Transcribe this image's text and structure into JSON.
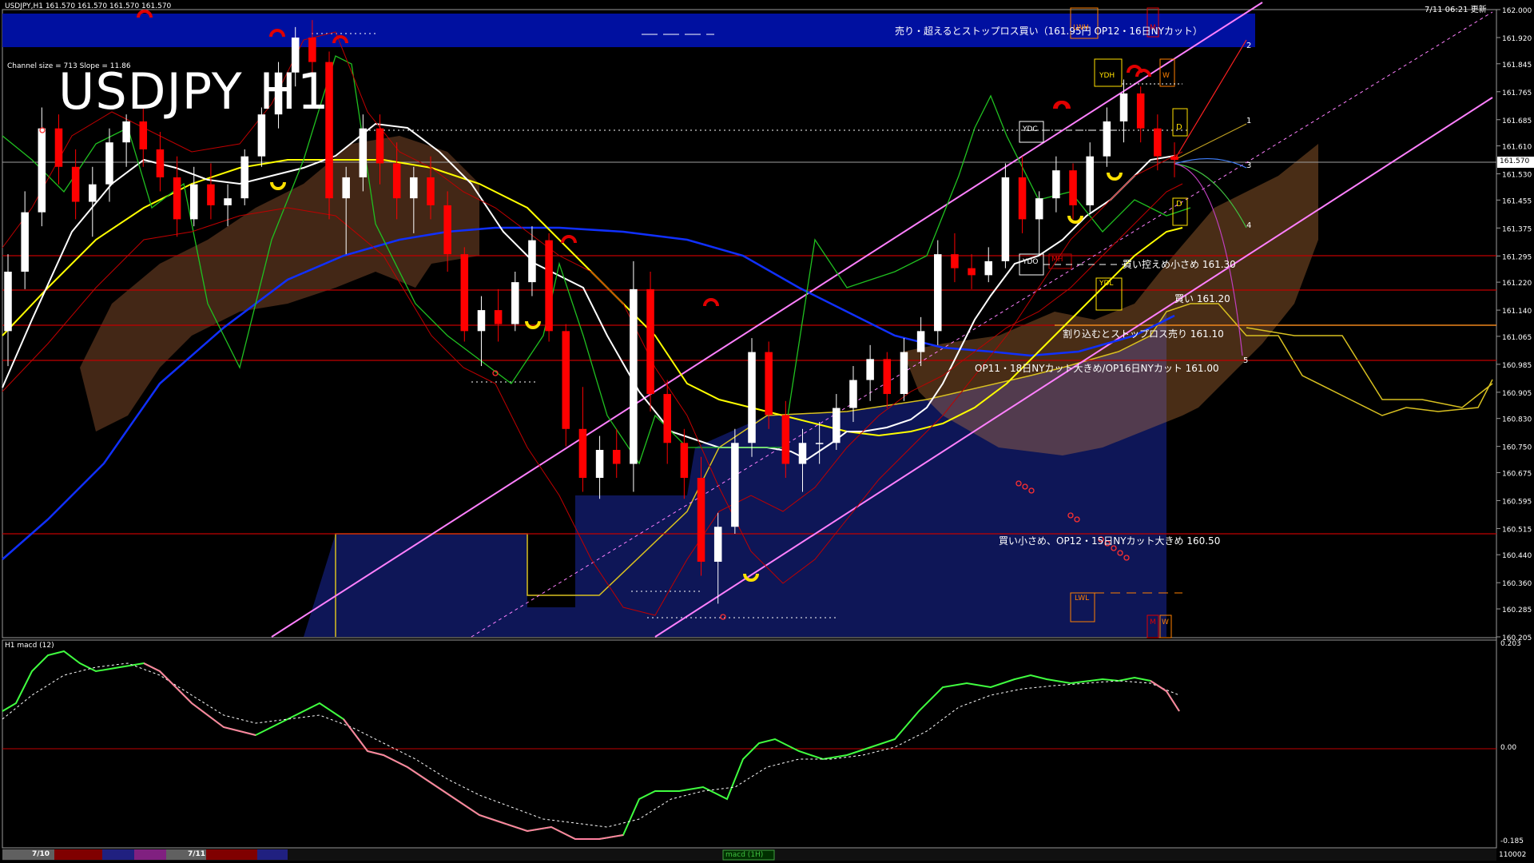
{
  "header": {
    "symbol_line": "USDJPY,H1  161.570 161.570 161.570 161.570",
    "timestamp": "7/11 06:21 更新",
    "big_title": "USDJPY H1",
    "channel_info": "Channel size = 713 Slope = 11.86",
    "banner_text": "売り・超えるとストップロス買い（161.95円 OP12・16日NYカット）"
  },
  "colors": {
    "background": "#000000",
    "bull_candle": "#ffffff",
    "bear_candle": "#ff0000",
    "ma_fast": "#ffffff",
    "ma_mid": "#ffff00",
    "ma_slow": "#0000ff",
    "channel": "#ff80ff",
    "banner": "#0010a0",
    "hline": "#c00000",
    "macd_up": "#40ff40",
    "macd_down": "#ff80a0",
    "grid_box": "#ffffff"
  },
  "price_axis": {
    "ticks": [
      "162.000",
      "161.920",
      "161.845",
      "161.765",
      "161.685",
      "161.610",
      "161.530",
      "161.455",
      "161.375",
      "161.295",
      "161.220",
      "161.140",
      "161.065",
      "160.985",
      "160.905",
      "160.830",
      "160.750",
      "160.675",
      "160.595",
      "160.515",
      "160.440",
      "160.360",
      "160.285",
      "160.205"
    ],
    "current_price": "161.570"
  },
  "annotations": {
    "level_161_30": "買い控えめ小さめ 161.30",
    "level_161_20": "買い 161.20",
    "level_161_10": "割り込むとストップロス売り 161.10",
    "level_161_00": "OP11・18日NYカット大きめ/OP16日NYカット 161.00",
    "level_160_50": "買い小さめ、OP12・15日NYカット大きめ 160.50"
  },
  "markers": {
    "ydc_top": "YDC",
    "ydo": "YDO",
    "ydh": "YDH",
    "ydl": "YDL",
    "lwh": "LWH",
    "lwl": "LWL",
    "mh": "MH",
    "m_top": "M",
    "w_top": "W",
    "d_upper": "D",
    "d_lower": "D",
    "m_bottom": "M",
    "w_bottom": "W"
  },
  "fib_labels": [
    "2",
    "1",
    "3",
    "4",
    "5"
  ],
  "macd": {
    "label": "H1  macd (12)",
    "axis_top": "0.203",
    "axis_zero": "0.00",
    "axis_bottom": "-0.185"
  },
  "footer": {
    "date_1": "7/10",
    "date_2": "7/11",
    "corner": "110002",
    "tab": "macd (1H)"
  },
  "chart_data": {
    "type": "candlestick",
    "title": "USDJPY H1",
    "ylim": [
      160.205,
      162.0
    ],
    "horizontal_levels": [
      161.3,
      161.2,
      161.1,
      161.0,
      160.5
    ],
    "candles": [
      {
        "o": 161.08,
        "h": 161.3,
        "l": 160.98,
        "c": 161.25
      },
      {
        "o": 161.25,
        "h": 161.48,
        "l": 161.2,
        "c": 161.42
      },
      {
        "o": 161.42,
        "h": 161.72,
        "l": 161.38,
        "c": 161.66
      },
      {
        "o": 161.66,
        "h": 161.7,
        "l": 161.5,
        "c": 161.55
      },
      {
        "o": 161.55,
        "h": 161.6,
        "l": 161.4,
        "c": 161.45
      },
      {
        "o": 161.45,
        "h": 161.55,
        "l": 161.35,
        "c": 161.5
      },
      {
        "o": 161.5,
        "h": 161.66,
        "l": 161.45,
        "c": 161.62
      },
      {
        "o": 161.62,
        "h": 161.7,
        "l": 161.55,
        "c": 161.68
      },
      {
        "o": 161.68,
        "h": 161.72,
        "l": 161.55,
        "c": 161.6
      },
      {
        "o": 161.6,
        "h": 161.65,
        "l": 161.48,
        "c": 161.52
      },
      {
        "o": 161.52,
        "h": 161.58,
        "l": 161.35,
        "c": 161.4
      },
      {
        "o": 161.4,
        "h": 161.55,
        "l": 161.38,
        "c": 161.5
      },
      {
        "o": 161.5,
        "h": 161.56,
        "l": 161.4,
        "c": 161.44
      },
      {
        "o": 161.44,
        "h": 161.5,
        "l": 161.38,
        "c": 161.46
      },
      {
        "o": 161.46,
        "h": 161.6,
        "l": 161.44,
        "c": 161.58
      },
      {
        "o": 161.58,
        "h": 161.72,
        "l": 161.55,
        "c": 161.7
      },
      {
        "o": 161.7,
        "h": 161.85,
        "l": 161.66,
        "c": 161.82
      },
      {
        "o": 161.82,
        "h": 161.95,
        "l": 161.78,
        "c": 161.92
      },
      {
        "o": 161.92,
        "h": 161.97,
        "l": 161.8,
        "c": 161.85
      },
      {
        "o": 161.85,
        "h": 161.88,
        "l": 161.4,
        "c": 161.46
      },
      {
        "o": 161.46,
        "h": 161.55,
        "l": 161.3,
        "c": 161.52
      },
      {
        "o": 161.52,
        "h": 161.7,
        "l": 161.48,
        "c": 161.66
      },
      {
        "o": 161.66,
        "h": 161.7,
        "l": 161.5,
        "c": 161.56
      },
      {
        "o": 161.56,
        "h": 161.62,
        "l": 161.4,
        "c": 161.46
      },
      {
        "o": 161.46,
        "h": 161.55,
        "l": 161.36,
        "c": 161.52
      },
      {
        "o": 161.52,
        "h": 161.58,
        "l": 161.4,
        "c": 161.44
      },
      {
        "o": 161.44,
        "h": 161.48,
        "l": 161.25,
        "c": 161.3
      },
      {
        "o": 161.3,
        "h": 161.32,
        "l": 161.05,
        "c": 161.08
      },
      {
        "o": 161.08,
        "h": 161.18,
        "l": 160.98,
        "c": 161.14
      },
      {
        "o": 161.14,
        "h": 161.2,
        "l": 161.05,
        "c": 161.1
      },
      {
        "o": 161.1,
        "h": 161.25,
        "l": 161.08,
        "c": 161.22
      },
      {
        "o": 161.22,
        "h": 161.38,
        "l": 161.18,
        "c": 161.34
      },
      {
        "o": 161.34,
        "h": 161.36,
        "l": 161.05,
        "c": 161.08
      },
      {
        "o": 161.08,
        "h": 161.1,
        "l": 160.75,
        "c": 160.8
      },
      {
        "o": 160.8,
        "h": 160.92,
        "l": 160.62,
        "c": 160.66
      },
      {
        "o": 160.66,
        "h": 160.78,
        "l": 160.6,
        "c": 160.74
      },
      {
        "o": 160.74,
        "h": 160.8,
        "l": 160.66,
        "c": 160.7
      },
      {
        "o": 160.7,
        "h": 161.28,
        "l": 160.62,
        "c": 161.2
      },
      {
        "o": 161.2,
        "h": 161.25,
        "l": 160.85,
        "c": 160.9
      },
      {
        "o": 160.9,
        "h": 160.94,
        "l": 160.7,
        "c": 160.76
      },
      {
        "o": 160.76,
        "h": 160.8,
        "l": 160.6,
        "c": 160.66
      },
      {
        "o": 160.66,
        "h": 160.72,
        "l": 160.38,
        "c": 160.42
      },
      {
        "o": 160.42,
        "h": 160.56,
        "l": 160.3,
        "c": 160.52
      },
      {
        "o": 160.52,
        "h": 160.8,
        "l": 160.5,
        "c": 160.76
      },
      {
        "o": 160.76,
        "h": 161.06,
        "l": 160.72,
        "c": 161.02
      },
      {
        "o": 161.02,
        "h": 161.05,
        "l": 160.8,
        "c": 160.84
      },
      {
        "o": 160.84,
        "h": 160.88,
        "l": 160.66,
        "c": 160.7
      },
      {
        "o": 160.7,
        "h": 160.8,
        "l": 160.62,
        "c": 160.76
      },
      {
        "o": 160.76,
        "h": 160.82,
        "l": 160.7,
        "c": 160.76
      },
      {
        "o": 160.76,
        "h": 160.9,
        "l": 160.74,
        "c": 160.86
      },
      {
        "o": 160.86,
        "h": 160.98,
        "l": 160.82,
        "c": 160.94
      },
      {
        "o": 160.94,
        "h": 161.04,
        "l": 160.88,
        "c": 161.0
      },
      {
        "o": 161.0,
        "h": 161.02,
        "l": 160.86,
        "c": 160.9
      },
      {
        "o": 160.9,
        "h": 161.06,
        "l": 160.88,
        "c": 161.02
      },
      {
        "o": 161.02,
        "h": 161.12,
        "l": 160.98,
        "c": 161.08
      },
      {
        "o": 161.08,
        "h": 161.34,
        "l": 161.04,
        "c": 161.3
      },
      {
        "o": 161.3,
        "h": 161.36,
        "l": 161.22,
        "c": 161.26
      },
      {
        "o": 161.26,
        "h": 161.3,
        "l": 161.2,
        "c": 161.24
      },
      {
        "o": 161.24,
        "h": 161.32,
        "l": 161.22,
        "c": 161.28
      },
      {
        "o": 161.28,
        "h": 161.56,
        "l": 161.26,
        "c": 161.52
      },
      {
        "o": 161.52,
        "h": 161.58,
        "l": 161.36,
        "c": 161.4
      },
      {
        "o": 161.4,
        "h": 161.48,
        "l": 161.3,
        "c": 161.46
      },
      {
        "o": 161.46,
        "h": 161.58,
        "l": 161.42,
        "c": 161.54
      },
      {
        "o": 161.54,
        "h": 161.56,
        "l": 161.4,
        "c": 161.44
      },
      {
        "o": 161.44,
        "h": 161.62,
        "l": 161.42,
        "c": 161.58
      },
      {
        "o": 161.58,
        "h": 161.72,
        "l": 161.55,
        "c": 161.68
      },
      {
        "o": 161.68,
        "h": 161.8,
        "l": 161.62,
        "c": 161.76
      },
      {
        "o": 161.76,
        "h": 161.78,
        "l": 161.62,
        "c": 161.66
      },
      {
        "o": 161.66,
        "h": 161.7,
        "l": 161.54,
        "c": 161.58
      },
      {
        "o": 161.58,
        "h": 161.62,
        "l": 161.52,
        "c": 161.57
      }
    ]
  }
}
